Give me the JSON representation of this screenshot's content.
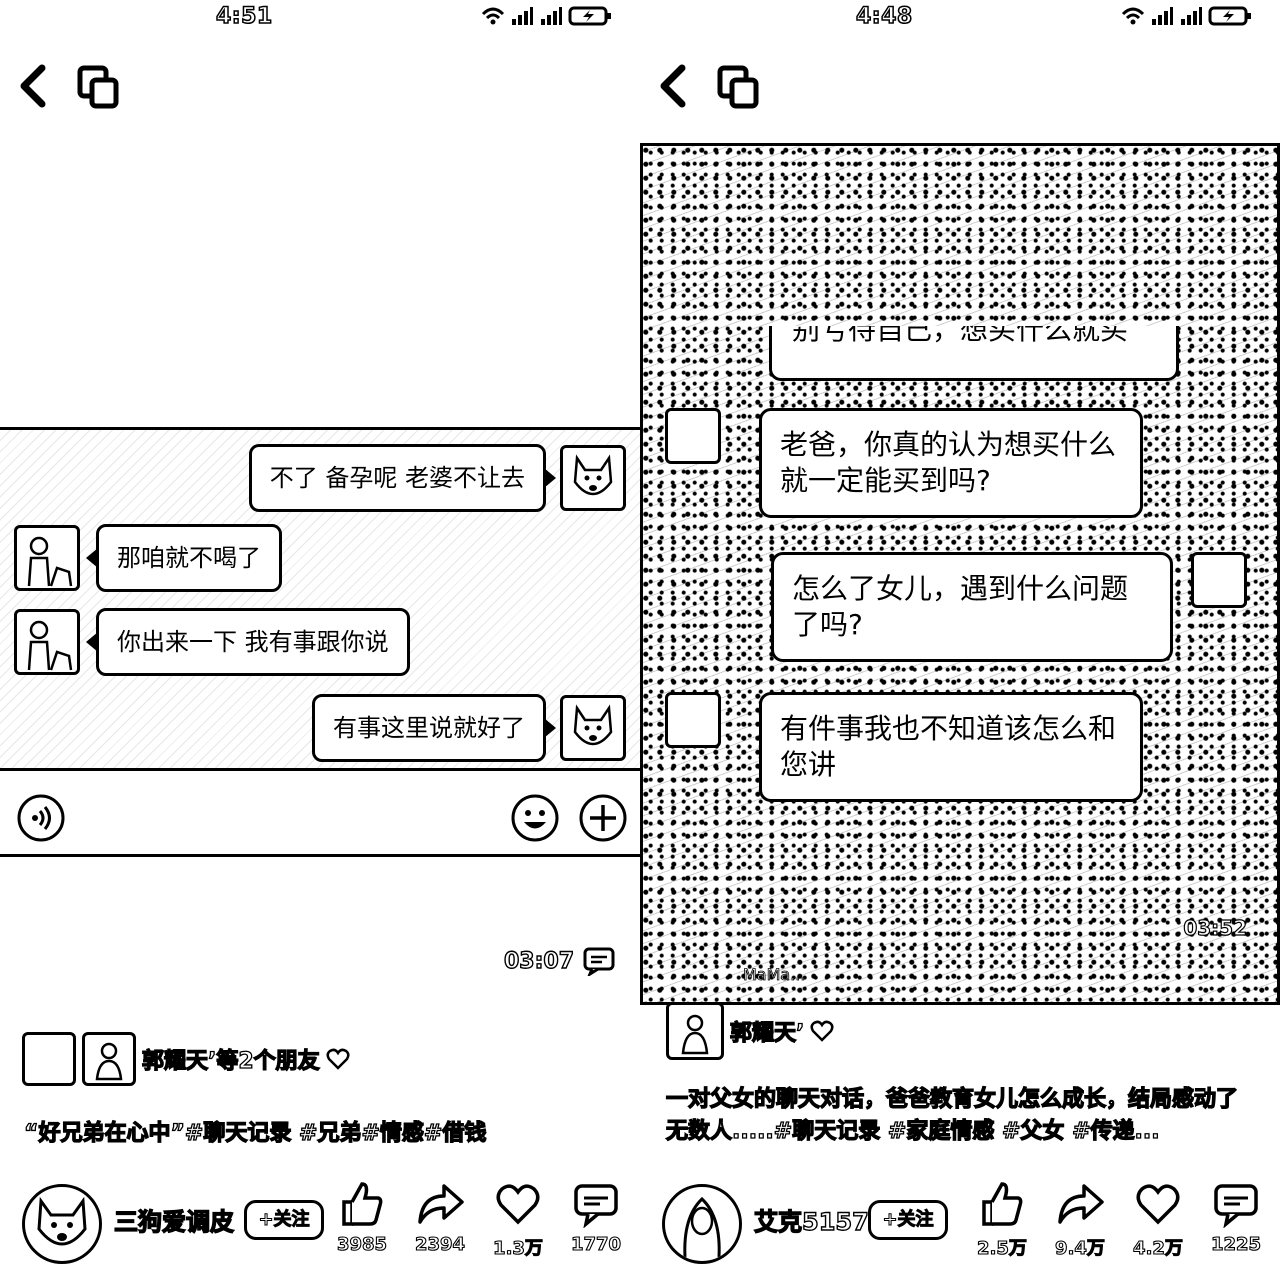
{
  "left": {
    "status": {
      "time": "4:51"
    },
    "chat": {
      "messages": [
        {
          "side": "right",
          "text": "不了 备孕呢 老婆不让去"
        },
        {
          "side": "left",
          "text": "那咱就不喝了"
        },
        {
          "side": "left",
          "text": "你出来一下 我有事跟你说"
        },
        {
          "side": "right",
          "text": "有事这里说就好了"
        }
      ]
    },
    "duration": "03:07",
    "friends": "郭耀天’等2个朋友",
    "caption": "“好兄弟在心中”#聊天记录 #兄弟#情感#借钱",
    "author": {
      "name": "三狗爱调皮",
      "follow": "+关注"
    },
    "actions": {
      "likes": "3985",
      "shares": "2394",
      "favorites": "1.3万",
      "comments": "1770"
    }
  },
  "right": {
    "status": {
      "time": "4:48"
    },
    "video": {
      "cut_message": "别亏待自己，想买什么就买",
      "messages": [
        {
          "text": "老爸，你真的认为想买什么就一定能买到吗?"
        },
        {
          "text": "怎么了女儿，遇到什么问题了吗?"
        },
        {
          "text": "有件事我也不知道该怎么和您讲"
        }
      ],
      "time": "03:52",
      "overlay_text": "MaMa..."
    },
    "friends": "郭耀天’",
    "caption": "一对父女的聊天对话，爸爸教育女儿怎么成长，结局感动了无数人.....#聊天记录 #家庭情感 #父女 #传递...",
    "author": {
      "name": "艾克5157",
      "follow": "+关注"
    },
    "actions": {
      "likes": "2.5万",
      "shares": "9.4万",
      "favorites": "4.2万",
      "comments": "1225"
    }
  },
  "icons": {
    "back": "chevron-left-icon",
    "copy": "copy-icon",
    "voice": "voice-icon",
    "emoji": "emoji-icon",
    "plus": "plus-icon",
    "like": "thumbs-up-icon",
    "share": "share-arrow-icon",
    "favorite": "heart-icon",
    "comment": "comment-icon"
  }
}
